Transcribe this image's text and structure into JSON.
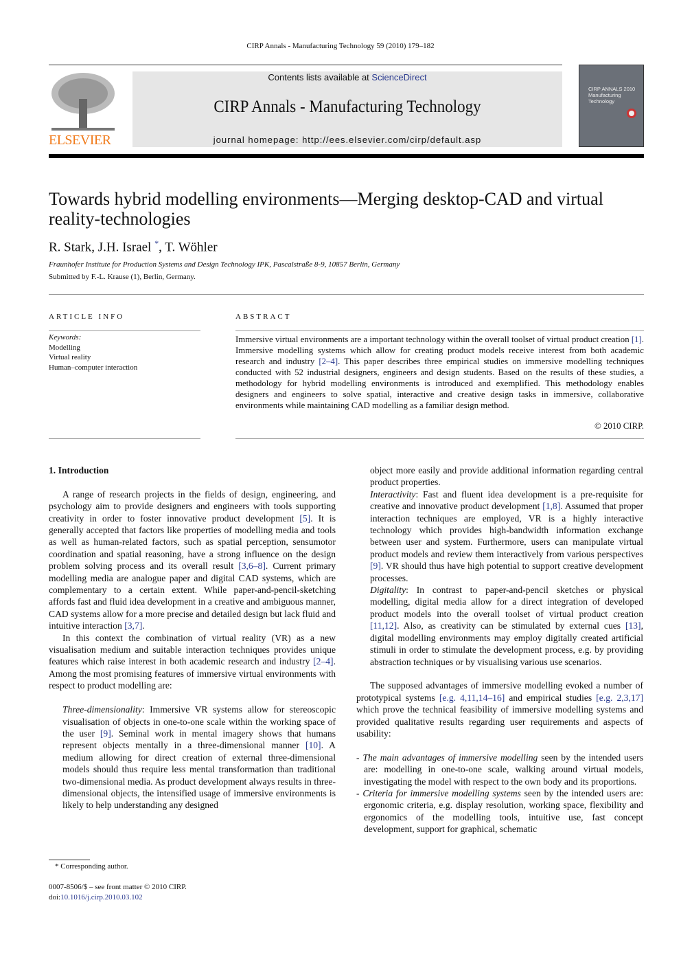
{
  "running_head": "CIRP Annals - Manufacturing Technology 59 (2010) 179–182",
  "header": {
    "publisher_logo": "ELSEVIER",
    "contents_prefix": "Contents lists available at ",
    "contents_link": "ScienceDirect",
    "journal_title": "CIRP Annals - Manufacturing Technology",
    "homepage": "journal homepage: http://ees.elsevier.com/cirp/default.asp",
    "cover_text": "CIRP ANNALS 2010 Manufacturing Technology",
    "link_color": "#2a3a8f",
    "logo_color": "#f07a1a"
  },
  "article": {
    "title": "Towards hybrid modelling environments—Merging desktop-CAD and virtual reality-technologies",
    "authors_a": "R. Stark, J.H. Israel ",
    "authors_star": "*",
    "authors_b": ", T. Wöhler",
    "affiliation": "Fraunhofer Institute for Production Systems and Design Technology IPK, Pascalstraße 8-9, 10857 Berlin, Germany",
    "submitted": "Submitted by F.-L. Krause (1), Berlin, Germany."
  },
  "article_info": {
    "heading": "ARTICLE INFO",
    "keywords_label": "Keywords:",
    "keywords": [
      "Modelling",
      "Virtual reality",
      "Human–computer interaction"
    ]
  },
  "abstract": {
    "heading": "ABSTRACT",
    "segments": [
      [
        "Immersive virtual environments are a important technology within the overall toolset of virtual product creation ",
        ""
      ],
      [
        "[1]",
        "r"
      ],
      [
        ". Immersive modelling systems which allow for creating product models receive interest from both academic research and industry ",
        ""
      ],
      [
        "[2–4]",
        "r"
      ],
      [
        ". This paper describes three empirical studies on immersive modelling techniques conducted with 52 industrial designers, engineers and design students. Based on the results of these studies, a methodology for hybrid modelling environments is introduced and exemplified. This methodology enables designers and engineers to solve spatial, interactive and creative design tasks in immersive, collaborative environments while maintaining CAD modelling as a familiar design method.",
        ""
      ]
    ],
    "copyright": "© 2010 CIRP."
  },
  "body": {
    "left": [
      {
        "cls": "h1",
        "seg": [
          [
            "1.  Introduction",
            ""
          ]
        ]
      },
      {
        "cls": "gap",
        "seg": []
      },
      {
        "cls": "ind",
        "seg": [
          [
            "A range of research projects in the fields of design, engineering, and psychology aim to provide designers and engineers with tools supporting creativity in order to foster innovative product development ",
            ""
          ],
          [
            "[5]",
            "r"
          ],
          [
            ". It is generally accepted that factors like properties of modelling media and tools as well as human-related factors, such as spatial perception, sensumotor coordination and spatial reasoning, have a strong influence on the design problem solving process and its overall result ",
            ""
          ],
          [
            "[3,6–8]",
            "r"
          ],
          [
            ". Current primary modelling media are analogue paper and digital CAD systems, which are complementary to a certain extent. While paper-and-pencil-sketching affords fast and fluid idea development in a creative and ambiguous manner, CAD systems allow for a more precise and detailed design but lack fluid and intuitive interaction ",
            ""
          ],
          [
            "[3,7]",
            "r"
          ],
          [
            ".",
            ""
          ]
        ]
      },
      {
        "cls": "ind",
        "seg": [
          [
            "In this context the combination of virtual reality (VR) as a new visualisation medium and suitable interaction techniques provides unique features which raise interest in both academic research and industry ",
            ""
          ],
          [
            "[2–4]",
            "r"
          ],
          [
            ". Among the most promising features of immersive virtual environments with respect to product modelling are:",
            ""
          ]
        ]
      },
      {
        "cls": "gap",
        "seg": []
      },
      {
        "cls": "blk",
        "seg": [
          [
            "Three-dimensionality",
            "i"
          ],
          [
            ": Immersive VR systems allow for stereoscopic visualisation of objects in one-to-one scale within the working space of the user ",
            ""
          ],
          [
            "[9]",
            "r"
          ],
          [
            ". Seminal work in mental imagery shows that humans represent objects mentally in a three-dimensional manner ",
            ""
          ],
          [
            "[10]",
            "r"
          ],
          [
            ". A medium allowing for direct creation of external three-dimensional models should thus require less mental transformation than traditional two-dimensional media. As product development always results in three-dimensional objects, the intensified usage of immersive environments is likely to help understanding any designed",
            ""
          ]
        ]
      }
    ],
    "right": [
      {
        "cls": "blk",
        "seg": [
          [
            "object more easily and provide additional information regarding central product properties.",
            ""
          ]
        ]
      },
      {
        "cls": "blk",
        "seg": [
          [
            "Interactivity",
            "i"
          ],
          [
            ": Fast and fluent idea development is a pre-requisite for creative and innovative product development ",
            ""
          ],
          [
            "[1,8]",
            "r"
          ],
          [
            ". Assumed that proper interaction techniques are employed, VR is a highly interactive technology which provides high-bandwidth information exchange between user and system. Furthermore, users can manipulate virtual product models and review them interactively from various perspectives ",
            ""
          ],
          [
            "[9]",
            "r"
          ],
          [
            ". VR should thus have high potential to support creative development processes.",
            ""
          ]
        ]
      },
      {
        "cls": "blk",
        "seg": [
          [
            "Digitality",
            "i"
          ],
          [
            ": In contrast to paper-and-pencil sketches or physical modelling, digital media allow for a direct integration of developed product models into the overall toolset of virtual product creation ",
            ""
          ],
          [
            "[11,12]",
            "r"
          ],
          [
            ". Also, as creativity can be stimulated by external cues ",
            ""
          ],
          [
            "[13]",
            "r"
          ],
          [
            ", digital modelling environments may employ digitally created artificial stimuli in order to stimulate the development process, e.g. by providing abstraction techniques or by visualising various use scenarios.",
            ""
          ]
        ]
      },
      {
        "cls": "gap",
        "seg": []
      },
      {
        "cls": "ind",
        "seg": [
          [
            "The supposed advantages of immersive modelling evoked a number of prototypical systems ",
            ""
          ],
          [
            "[e.g. 4,11,14–16]",
            "r"
          ],
          [
            " and empirical studies ",
            ""
          ],
          [
            "[e.g. 2,3,17]",
            "r"
          ],
          [
            " which prove the technical feasibility of immersive modelling systems and provided qualitative results regarding user requirements and aspects of usability:",
            ""
          ]
        ]
      },
      {
        "cls": "gap",
        "seg": []
      },
      {
        "cls": "li",
        "seg": [
          [
            "- ",
            ""
          ],
          [
            "The main advantages of immersive modelling",
            "i"
          ],
          [
            " seen by the intended users are: modelling in one-to-one scale, walking around virtual models, investigating the model with respect to the own body and its proportions.",
            ""
          ]
        ]
      },
      {
        "cls": "li",
        "seg": [
          [
            "- ",
            ""
          ],
          [
            "Criteria for immersive modelling systems",
            "i"
          ],
          [
            " seen by the intended users are: ergonomic criteria, e.g. display resolution, working space, flexibility and ergonomics of the modelling tools, intuitive use, fast concept development, support for graphical, schematic",
            ""
          ]
        ]
      }
    ]
  },
  "footer": {
    "footnote": "* Corresponding author.",
    "issn": "0007-8506/$ – see front matter © 2010 CIRP.",
    "doi_prefix": "doi:",
    "doi": "10.1016/j.cirp.2010.03.102"
  }
}
